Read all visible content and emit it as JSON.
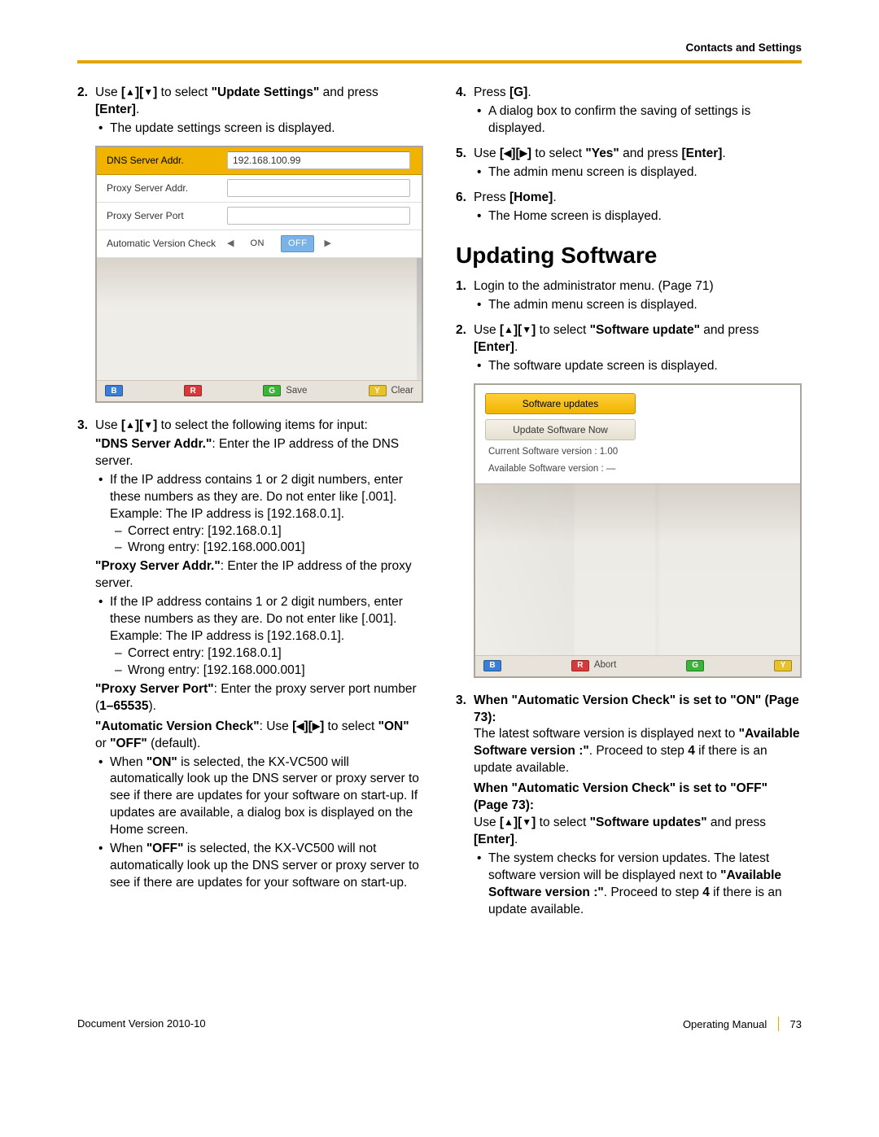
{
  "header": {
    "section": "Contacts and Settings"
  },
  "left": {
    "step2": {
      "n": "2.",
      "text_a": "Use ",
      "text_b": " to select ",
      "target": "\"Update Settings\"",
      "text_c": " and press ",
      "enter": "[Enter]",
      "text_d": ".",
      "sub": "The update settings screen is displayed."
    },
    "shot": {
      "row1": {
        "label": "DNS Server Addr.",
        "value": "192.168.100.99"
      },
      "row2": {
        "label": "Proxy Server Addr."
      },
      "row3": {
        "label": "Proxy Server Port"
      },
      "row4": {
        "label": "Automatic Version Check",
        "on": "ON",
        "off": "OFF"
      },
      "foot": {
        "b": "B",
        "r": "R",
        "g": "G",
        "glab": "Save",
        "y": "Y",
        "ylab": "Clear"
      }
    },
    "step3": {
      "n": "3.",
      "text_a": "Use ",
      "text_b": " to select the following items for input:",
      "dns_b": "\"DNS Server Addr.\"",
      "dns_t": ": Enter the IP address of the DNS server.",
      "ip_rule": "If the IP address contains 1 or 2 digit numbers, enter these numbers as they are. Do not enter like [.001].",
      "ip_ex": "Example: The IP address is [192.168.0.1].",
      "ip_ok": "Correct entry: [192.168.0.1]",
      "ip_bad": "Wrong entry: [192.168.000.001]",
      "proxy_b": "\"Proxy Server Addr.\"",
      "proxy_t": ": Enter the IP address of the proxy server.",
      "port_b": "\"Proxy Server Port\"",
      "port_t": ": Enter the proxy server port number (",
      "port_range": "1–65535",
      "port_t2": ").",
      "avc_b": "\"Automatic Version Check\"",
      "avc_t1": ": Use ",
      "avc_t2": " to select ",
      "avc_on": "\"ON\"",
      "avc_or": " or ",
      "avc_off": "\"OFF\"",
      "avc_def": " (default).",
      "on_txt1": "When ",
      "on_b": "\"ON\"",
      "on_txt2": " is selected, the KX-VC500 will automatically look up the DNS server or proxy server to see if there are updates for your software on start-up. If updates are available, a dialog box is displayed on the Home screen.",
      "off_txt1": "When ",
      "off_b": "\"OFF\"",
      "off_txt2": " is selected, the KX-VC500 will not automatically look up the DNS server or proxy server to see if there are updates for your software on start-up."
    }
  },
  "right": {
    "step4": {
      "n": "4.",
      "text_a": "Press ",
      "g": "[G]",
      "text_b": ".",
      "sub": "A dialog box to confirm the saving of settings is displayed."
    },
    "step5": {
      "n": "5.",
      "text_a": "Use ",
      "text_b": " to select ",
      "yes": "\"Yes\"",
      "text_c": " and press ",
      "enter": "[Enter]",
      "text_d": ".",
      "sub": "The admin menu screen is displayed."
    },
    "step6": {
      "n": "6.",
      "text_a": "Press ",
      "home": "[Home]",
      "text_b": ".",
      "sub": "The Home screen is displayed."
    },
    "heading": "Updating Software",
    "u1": {
      "n": "1.",
      "text": "Login to the administrator menu. (Page 71)",
      "sub": "The admin menu screen is displayed."
    },
    "u2": {
      "n": "2.",
      "text_a": "Use ",
      "text_b": " to select ",
      "target": "\"Software update\"",
      "text_c": " and press ",
      "enter": "[Enter]",
      "text_d": ".",
      "sub": "The software update screen is displayed."
    },
    "shot": {
      "pill1": "Software updates",
      "pill2": "Update Software Now",
      "info1": "Current Software version : 1.00",
      "info2": "Available Software version : —",
      "foot": {
        "b": "B",
        "r": "R",
        "rlab": "Abort",
        "g": "G",
        "y": "Y"
      }
    },
    "u3": {
      "n": "3.",
      "on_b": "When \"Automatic Version Check\" is set to \"ON\" (Page 73):",
      "on_t1": "The latest software version is displayed next to ",
      "on_bb": "\"Available Software version :\"",
      "on_t2": ". Proceed to step ",
      "on_step": "4",
      "on_t3": " if there is an update available.",
      "off_b": "When \"Automatic Version Check\" is set to \"OFF\" (Page 73):",
      "off_t1": "Use ",
      "off_t2": " to select ",
      "off_target": "\"Software updates\"",
      "off_t3": " and press ",
      "off_enter": "[Enter]",
      "off_t4": ".",
      "sub_t1": "The system checks for version updates. The latest software version will be displayed next to ",
      "sub_b": "\"Available Software version :\"",
      "sub_t2": ". Proceed to step ",
      "sub_step": "4",
      "sub_t3": " if there is an update available."
    }
  },
  "footer": {
    "left": "Document Version  2010-10",
    "right_a": "Operating Manual",
    "right_b": "73"
  }
}
